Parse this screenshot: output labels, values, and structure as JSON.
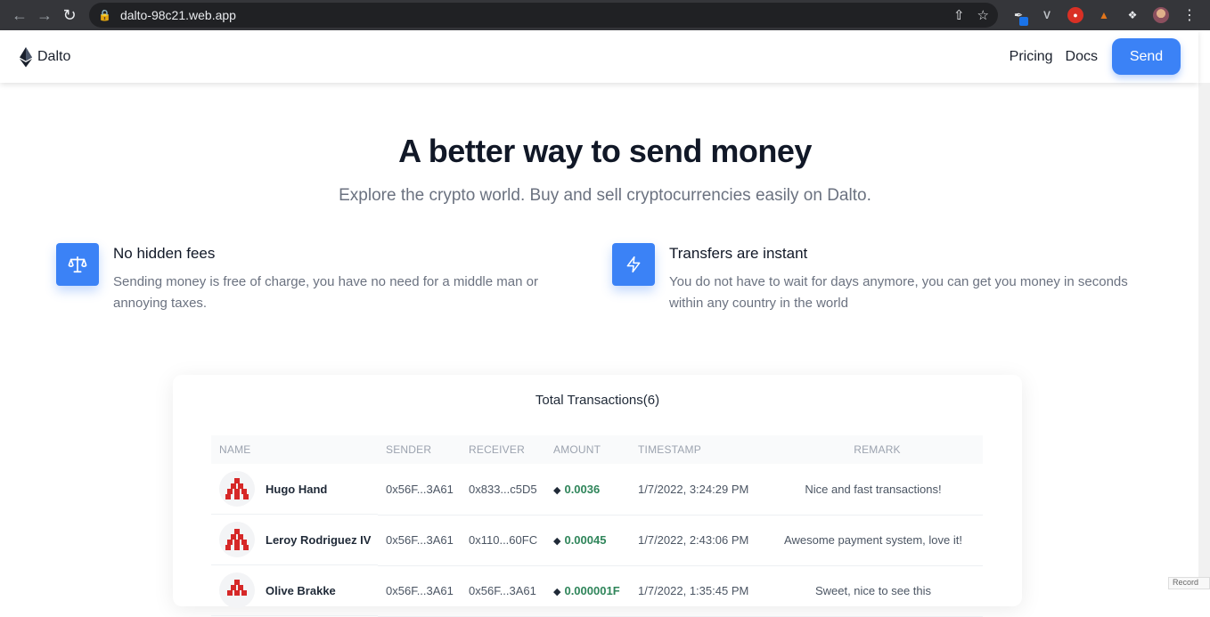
{
  "browser": {
    "url": "dalto-98c21.web.app"
  },
  "navbar": {
    "brand": "Dalto",
    "links": [
      "Pricing",
      "Docs"
    ],
    "send_label": "Send"
  },
  "hero": {
    "title": "A better way to send money",
    "subtitle": "Explore the crypto world. Buy and sell cryptocurrencies easily on Dalto."
  },
  "features": [
    {
      "icon": "scale-icon",
      "title": "No hidden fees",
      "description": "Sending money is free of charge, you have no need for a middle man or annoying taxes."
    },
    {
      "icon": "lightning-icon",
      "title": "Transfers are instant",
      "description": "You do not have to wait for days anymore, you can get you money in seconds within any country in the world"
    }
  ],
  "transactions": {
    "title": "Total Transactions(6)",
    "headers": [
      "NAME",
      "SENDER",
      "RECEIVER",
      "AMOUNT",
      "TIMESTAMP",
      "REMARK"
    ],
    "rows": [
      {
        "name": "Hugo Hand",
        "sender": "0x56F...3A61",
        "receiver": "0x833...c5D5",
        "amount": "0.0036",
        "timestamp": "1/7/2022, 3:24:29 PM",
        "remark": "Nice and fast transactions!"
      },
      {
        "name": "Leroy Rodriguez IV",
        "sender": "0x56F...3A61",
        "receiver": "0x110...60FC",
        "amount": "0.00045",
        "timestamp": "1/7/2022, 2:43:06 PM",
        "remark": "Awesome payment system, love it!"
      },
      {
        "name": "Olive Brakke",
        "sender": "0x56F...3A61",
        "receiver": "0x56F...3A61",
        "amount": "0.000001F",
        "timestamp": "1/7/2022, 1:35:45 PM",
        "remark": "Sweet, nice to see this"
      }
    ]
  },
  "colors": {
    "accent": "#3b82f6",
    "amount": "#2f855a"
  },
  "overlay": {
    "record_label": "Record"
  }
}
